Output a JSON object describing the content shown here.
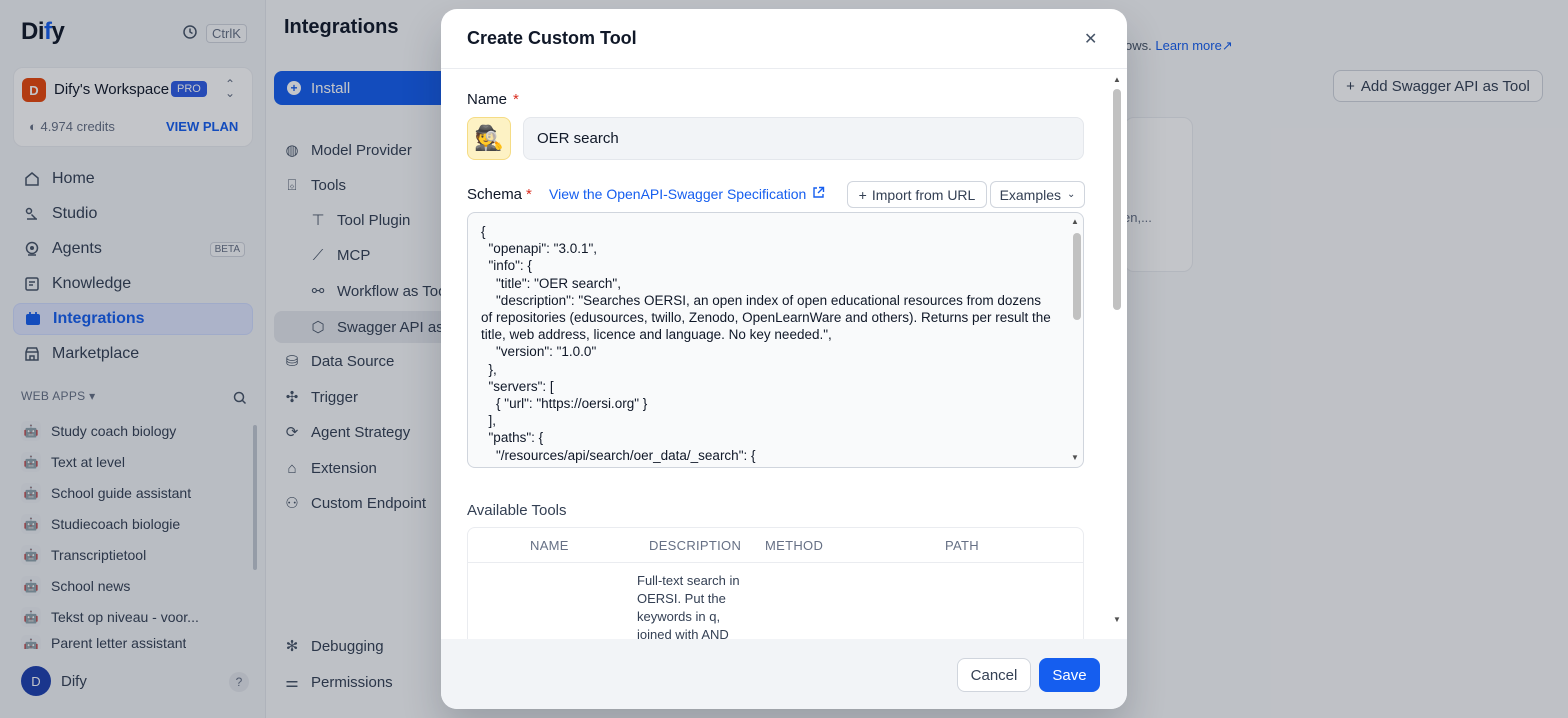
{
  "sidebar": {
    "logo_pre": "Di",
    "logo_accent": "f",
    "logo_post": "y",
    "shortcut": "CtrlK",
    "workspace": {
      "initial": "D",
      "name": "Dify's Workspace",
      "badge": "PRO",
      "credits": "4.974 credits",
      "plan_link": "VIEW PLAN"
    },
    "nav": [
      {
        "label": "Home",
        "icon": "home-icon"
      },
      {
        "label": "Studio",
        "icon": "studio-icon"
      },
      {
        "label": "Agents",
        "icon": "agents-icon",
        "badge": "BETA"
      },
      {
        "label": "Knowledge",
        "icon": "knowledge-icon"
      },
      {
        "label": "Integrations",
        "icon": "integrations-icon",
        "active": true
      },
      {
        "label": "Marketplace",
        "icon": "marketplace-icon"
      }
    ],
    "web_apps_heading": "WEB APPS",
    "web_apps": [
      "Study coach biology",
      "Text at level",
      "School guide assistant",
      "Studiecoach biologie",
      "Transcriptietool",
      "School news",
      "Tekst op niveau - voor...",
      "Parent letter assistant"
    ],
    "user": {
      "initial": "D",
      "name": "Dify"
    },
    "help": "?"
  },
  "main": {
    "title": "Integrations",
    "install_label": "Install",
    "menu": [
      {
        "label": "Model Provider",
        "icon": "model-provider-icon"
      },
      {
        "label": "Tools",
        "icon": "tools-icon"
      },
      {
        "label": "Tool Plugin",
        "icon": "tool-plugin-icon",
        "sub": true
      },
      {
        "label": "MCP",
        "icon": "mcp-icon",
        "sub": true
      },
      {
        "label": "Workflow as Tool",
        "icon": "workflow-icon",
        "sub": true
      },
      {
        "label": "Swagger API as Tool",
        "icon": "swagger-icon",
        "sub": true,
        "active": true
      },
      {
        "label": "Data Source",
        "icon": "data-source-icon"
      },
      {
        "label": "Trigger",
        "icon": "trigger-icon"
      },
      {
        "label": "Agent Strategy",
        "icon": "agent-strategy-icon"
      },
      {
        "label": "Extension",
        "icon": "extension-icon"
      },
      {
        "label": "Custom Endpoint",
        "icon": "custom-endpoint-icon"
      },
      {
        "label": "Debugging",
        "icon": "debugging-icon"
      },
      {
        "label": "Permissions",
        "icon": "permissions-icon"
      }
    ],
    "learn_prefix": "ows.",
    "learn_more": "Learn more",
    "add_swagger_label": "Add Swagger API as Tool",
    "card_fragment": "en,..."
  },
  "modal": {
    "title": "Create Custom Tool",
    "name_label": "Name",
    "name_emoji": "🕵️",
    "name_value": "OER search",
    "schema_label": "Schema",
    "spec_link": "View the OpenAPI-Swagger Specification",
    "import_label": "Import from URL",
    "examples_label": "Examples",
    "schema_text": "{\n  \"openapi\": \"3.0.1\",\n  \"info\": {\n    \"title\": \"OER search\",\n    \"description\": \"Searches OERSI, an open index of open educational resources from dozens of repositories (edusources, twillo, Zenodo, OpenLearnWare and others). Returns per result the title, web address, licence and language. No key needed.\",\n    \"version\": \"1.0.0\"\n  },\n  \"servers\": [\n    { \"url\": \"https://oersi.org\" }\n  ],\n  \"paths\": {\n    \"/resources/api/search/oer_data/_search\": {\n      \"get\": {",
    "tools_label": "Available Tools",
    "table_headers": {
      "name": "NAME",
      "description": "DESCRIPTION",
      "method": "METHOD",
      "path": "PATH"
    },
    "tool_rows": [
      {
        "name": "",
        "description": "Full-text search in OERSI. Put the keywords in q, joined with AND",
        "method": "",
        "path": ""
      }
    ],
    "cancel_label": "Cancel",
    "save_label": "Save"
  },
  "colors": {
    "accent": "#155eef",
    "required": "#d92d20",
    "workspace_avatar": "#e8470b"
  }
}
